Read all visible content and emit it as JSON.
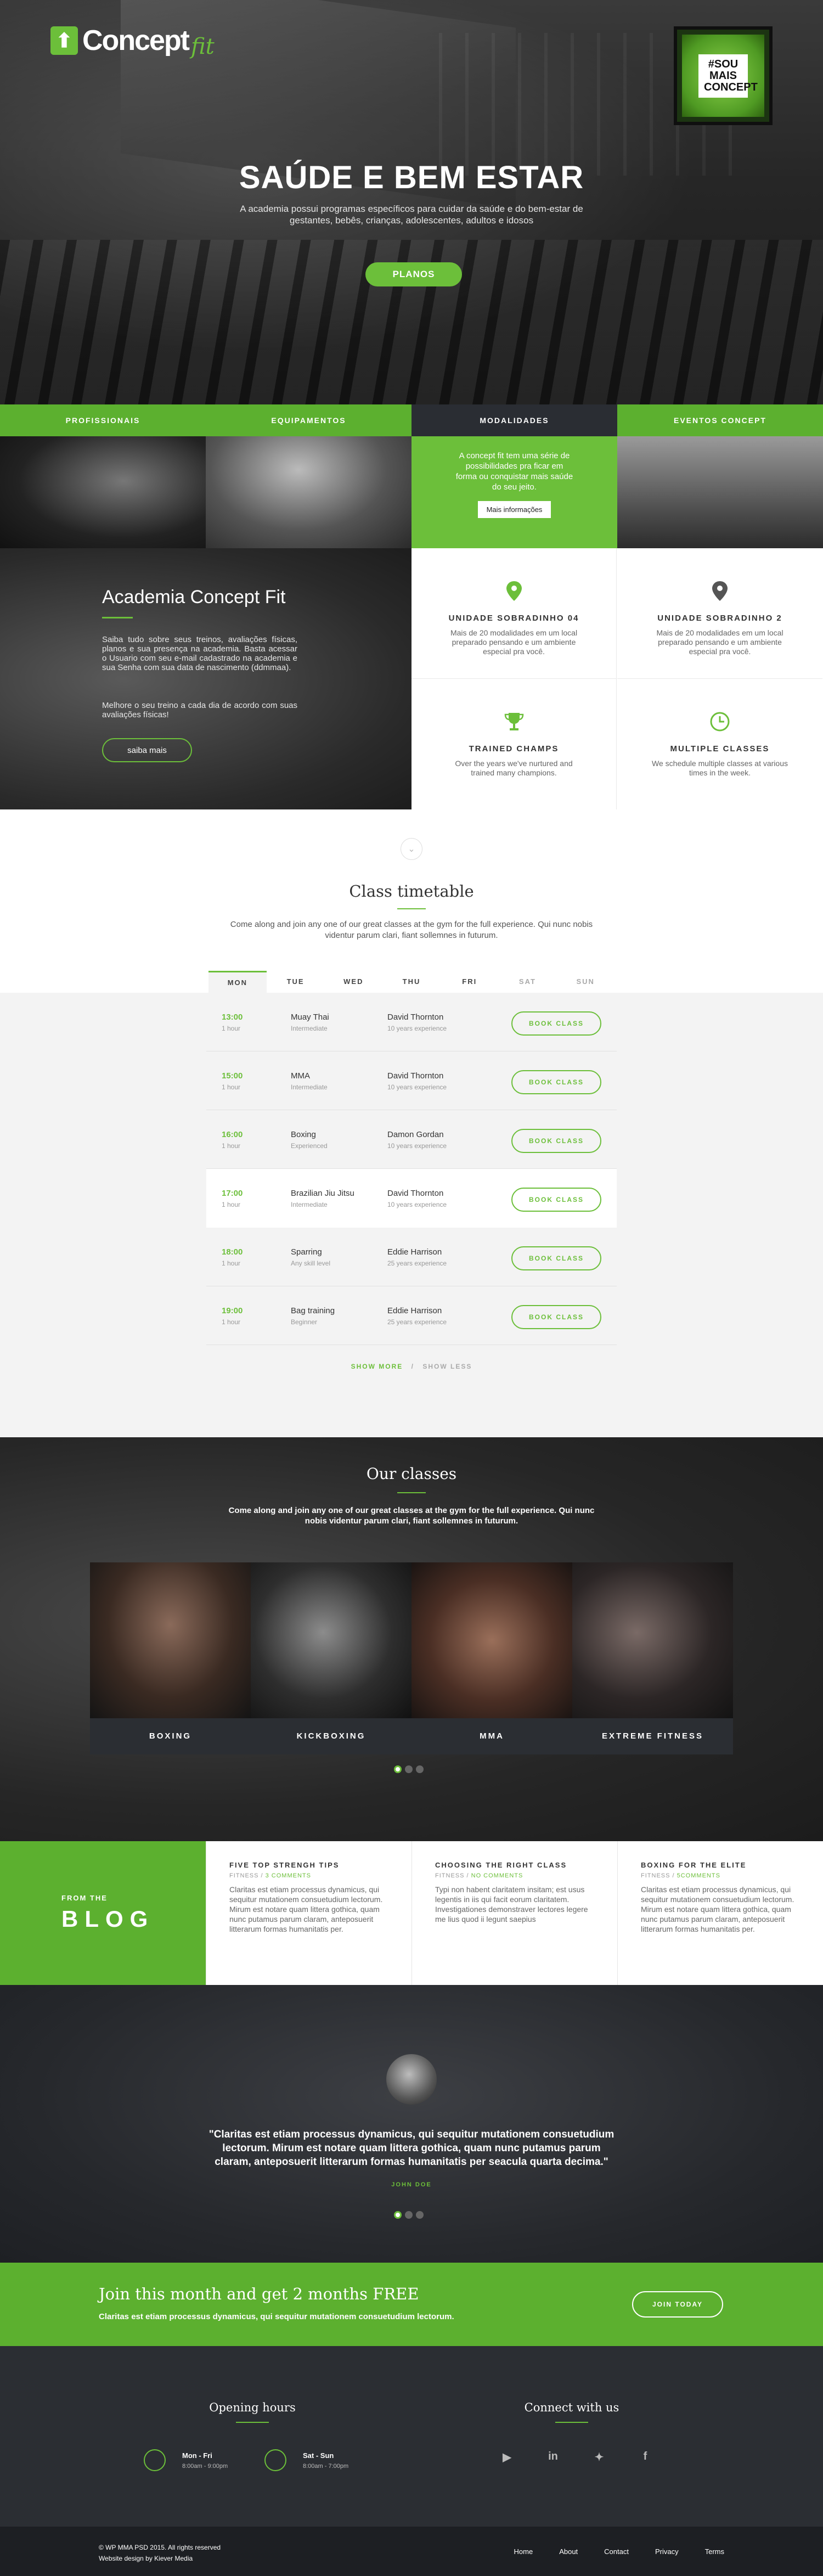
{
  "brand": {
    "name": "Concept",
    "script": "fit",
    "badge": "#SOU MAIS CONCEPT",
    "accent": "#6cbf3a"
  },
  "hero": {
    "title": "SAÚDE E BEM ESTAR",
    "subtitle": "A academia possui programas específicos para cuidar da saúde e do bem-estar de gestantes, bebês, crianças, adolescentes, adultos e idosos",
    "button": "PLANOS"
  },
  "features": {
    "tabs": [
      "PROFISSIONAIS",
      "EQUIPAMENTOS",
      "MODALIDADES",
      "EVENTOS CONCEPT"
    ],
    "modalidades_text": "A concept fit tem uma série de possibilidades pra ficar em forma ou conquistar mais saúde do seu jeito.",
    "modalidades_button": "Mais informações",
    "academia": {
      "title": "Academia Concept Fit",
      "p1": "Saiba tudo sobre seus treinos, avaliações físicas, planos e sua presença na academia. Basta acessar o Usuario com seu e-mail cadastrado na academia e sua Senha com sua data de nascimento (ddmmaa).",
      "p2": "Melhore o seu treino a cada dia de acordo com suas avaliações físicas!",
      "button": "saiba mais"
    },
    "cells": [
      {
        "icon": "location-pin-icon",
        "title": "UNIDADE SOBRADINHO 04",
        "text": "Mais de 20 modalidades em um local preparado pensando e um ambiente especial pra você."
      },
      {
        "icon": "location-pin-icon",
        "title": "UNIDADE SOBRADINHO 2",
        "text": "Mais de 20 modalidades em um local preparado pensando e um ambiente especial pra você."
      },
      {
        "icon": "trophy-icon",
        "title": "TRAINED CHAMPS",
        "text": "Over the years we've nurtured and trained many champions."
      },
      {
        "icon": "clock-icon",
        "title": "MULTIPLE CLASSES",
        "text": "We schedule multiple classes at various times in the week."
      }
    ]
  },
  "timetable": {
    "title": "Class timetable",
    "intro": "Come along and join any one of our great classes at the gym for the full experience. Qui nunc nobis videntur parum clari, fiant sollemnes in futurum.",
    "days": [
      "MON",
      "TUE",
      "WED",
      "THU",
      "FRI",
      "SAT",
      "SUN"
    ],
    "rows": [
      {
        "time": "13:00",
        "dur": "1 hour",
        "cls": "Muay Thai",
        "lvl": "Intermediate",
        "trainer": "David Thornton",
        "exp": "10 years experience",
        "btn": "BOOK CLASS"
      },
      {
        "time": "15:00",
        "dur": "1 hour",
        "cls": "MMA",
        "lvl": "Intermediate",
        "trainer": "David Thornton",
        "exp": "10 years experience",
        "btn": "BOOK CLASS"
      },
      {
        "time": "16:00",
        "dur": "1 hour",
        "cls": "Boxing",
        "lvl": "Experienced",
        "trainer": "Damon Gordan",
        "exp": "10 years experience",
        "btn": "BOOK CLASS"
      },
      {
        "time": "17:00",
        "dur": "1 hour",
        "cls": "Brazilian Jiu Jitsu",
        "lvl": "Intermediate",
        "trainer": "David Thornton",
        "exp": "10 years experience",
        "btn": "BOOK CLASS"
      },
      {
        "time": "18:00",
        "dur": "1 hour",
        "cls": "Sparring",
        "lvl": "Any skill level",
        "trainer": "Eddie Harrison",
        "exp": "25 years experience",
        "btn": "BOOK CLASS"
      },
      {
        "time": "19:00",
        "dur": "1 hour",
        "cls": "Bag training",
        "lvl": "Beginner",
        "trainer": "Eddie Harrison",
        "exp": "25 years experience",
        "btn": "BOOK CLASS"
      }
    ],
    "show_more": "SHOW MORE",
    "sep": "/",
    "show_less": "SHOW LESS"
  },
  "classes": {
    "title": "Our classes",
    "intro": "Come along and join any one of our great classes at the gym for the full experience. Qui nunc nobis videntur parum clari, fiant sollemnes in futurum.",
    "cards": [
      "BOXING",
      "KICKBOXING",
      "MMA",
      "EXTREME FITNESS"
    ]
  },
  "blog": {
    "from": "FROM THE",
    "title": "BLOG",
    "posts": [
      {
        "title": "FIVE TOP STRENGH TIPS",
        "cat": "FITNESS",
        "comments": "3 COMMENTS",
        "text": "Claritas est etiam processus dynamicus, qui sequitur mutationem consuetudium lectorum. Mirum est notare quam littera gothica, quam nunc putamus parum claram, anteposuerit litterarum formas humanitatis per."
      },
      {
        "title": "CHOOSING THE RIGHT CLASS",
        "cat": "FITNESS",
        "comments": "NO COMMENTS",
        "text": "Typi non habent claritatem insitam; est usus legentis in iis qui facit eorum claritatem. Investigationes demonstraver lectores legere me lius quod ii legunt saepius"
      },
      {
        "title": "BOXING FOR THE ELITE",
        "cat": "FITNESS",
        "comments": "5COMMENTS",
        "text": "Claritas est etiam processus dynamicus, qui sequitur mutationem consuetudium lectorum. Mirum est notare quam littera gothica, quam nunc putamus parum claram, anteposuerit litterarum formas humanitatis per."
      }
    ]
  },
  "testimonial": {
    "quote": "\"Claritas est etiam processus dynamicus, qui sequitur mutationem consuetudium lectorum. Mirum est notare quam littera gothica, quam nunc putamus parum claram, anteposuerit litterarum formas humanitatis per seacula quarta decima.\"",
    "author": "JOHN DOE"
  },
  "cta": {
    "title": "Join this month and get 2 months FREE",
    "sub": "Claritas est etiam processus dynamicus, qui sequitur mutationem consuetudium lectorum.",
    "button": "JOIN TODAY"
  },
  "footer": {
    "hours_title": "Opening hours",
    "hours": [
      {
        "days": "Mon - Fri",
        "time": "8:00am - 9:00pm"
      },
      {
        "days": "Sat - Sun",
        "time": "8:00am - 7:00pm"
      }
    ],
    "connect_title": "Connect with us",
    "social": [
      {
        "icon": "youtube-icon",
        "glyph": "▶"
      },
      {
        "icon": "linkedin-icon",
        "glyph": "in"
      },
      {
        "icon": "twitter-icon",
        "glyph": "✦"
      },
      {
        "icon": "facebook-icon",
        "glyph": "f"
      }
    ],
    "copyright": "© WP MMA PSD 2015. All rights reserved",
    "credit": "Website design by Kiever Media",
    "links": [
      "Home",
      "About",
      "Contact",
      "Privacy",
      "Terms"
    ]
  }
}
